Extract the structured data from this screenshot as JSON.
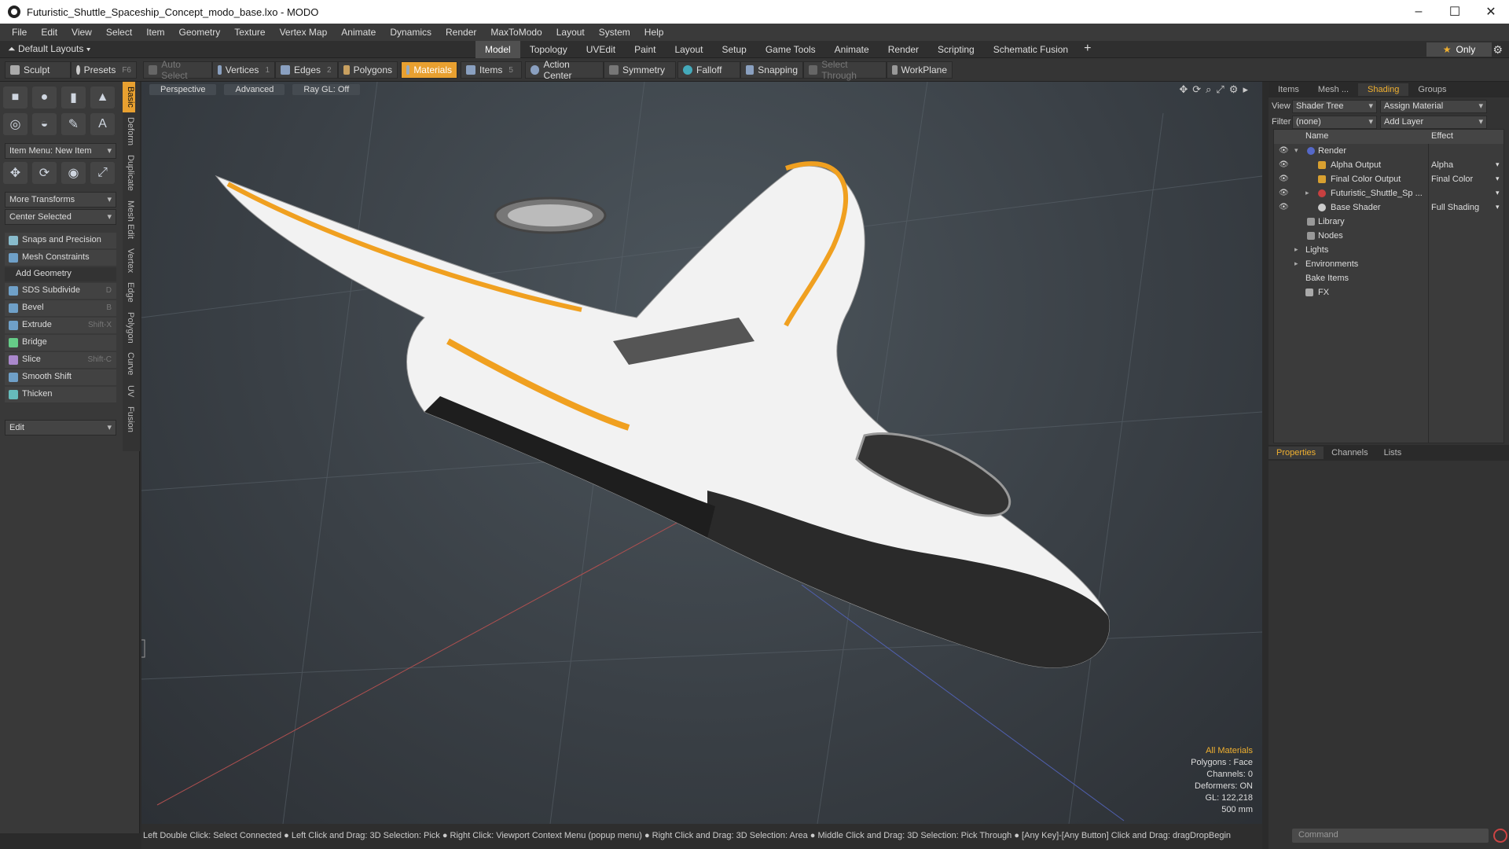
{
  "window": {
    "title": "Futuristic_Shuttle_Spaceship_Concept_modo_base.lxo - MODO"
  },
  "menu": [
    "File",
    "Edit",
    "View",
    "Select",
    "Item",
    "Geometry",
    "Texture",
    "Vertex Map",
    "Animate",
    "Dynamics",
    "Render",
    "MaxToModo",
    "Layout",
    "System",
    "Help"
  ],
  "layouts_label": "Default Layouts",
  "layout_tabs": [
    "Model",
    "Topology",
    "UVEdit",
    "Paint",
    "Layout",
    "Setup",
    "Game Tools",
    "Animate",
    "Render",
    "Scripting",
    "Schematic Fusion"
  ],
  "active_layout_tab": "Model",
  "only_label": "Only",
  "toolbar": {
    "sculpt": "Sculpt",
    "presets": "Presets",
    "presets_key": "F6",
    "auto_select": "Auto Select",
    "vertices": "Vertices",
    "vertices_key": "1",
    "edges": "Edges",
    "edges_key": "2",
    "polygons": "Polygons",
    "materials": "Materials",
    "items": "Items",
    "items_key": "5",
    "action_center": "Action Center",
    "symmetry": "Symmetry",
    "falloff": "Falloff",
    "snapping": "Snapping",
    "select_through": "Select Through",
    "workplane": "WorkPlane"
  },
  "left": {
    "vtabs": [
      "Basic",
      "Deform",
      "Duplicate",
      "Mesh Edit",
      "Vertex",
      "Edge",
      "Polygon",
      "Curve",
      "UV",
      "Fusion"
    ],
    "item_menu": "Item Menu: New Item",
    "more_transforms": "More Transforms",
    "center_selected": "Center Selected",
    "snaps": "Snaps and Precision",
    "mesh_constraints": "Mesh Constraints",
    "add_geometry": "Add Geometry",
    "tools": [
      {
        "label": "SDS Subdivide",
        "key": "D"
      },
      {
        "label": "Bevel",
        "key": "B"
      },
      {
        "label": "Extrude",
        "key": "Shift-X"
      },
      {
        "label": "Bridge",
        "key": ""
      },
      {
        "label": "Slice",
        "key": "Shift-C"
      },
      {
        "label": "Smooth Shift",
        "key": ""
      },
      {
        "label": "Thicken",
        "key": ""
      }
    ],
    "edit": "Edit"
  },
  "viewport": {
    "perspective": "Perspective",
    "advanced": "Advanced",
    "raygl": "Ray GL: Off",
    "info": {
      "materials": "All Materials",
      "polygons": "Polygons : Face",
      "channels": "Channels: 0",
      "deformers": "Deformers: ON",
      "gl": "GL: 122,218",
      "scale": "500 mm"
    }
  },
  "status": "Left Double Click: Select Connected ● Left Click and Drag: 3D Selection: Pick ● Right Click: Viewport Context Menu (popup menu) ● Right Click and Drag: 3D Selection: Area ● Middle Click and Drag: 3D Selection: Pick Through ● [Any Key]-[Any Button] Click and Drag: dragDropBegin",
  "right": {
    "tabs": [
      "Items",
      "Mesh ...",
      "Shading",
      "Groups"
    ],
    "active_tab": "Shading",
    "view_label": "View",
    "view_value": "Shader Tree",
    "assign_material": "Assign Material",
    "filter_label": "Filter",
    "filter_value": "(none)",
    "add_layer": "Add Layer",
    "col_name": "Name",
    "col_effect": "Effect",
    "tree": [
      {
        "name": "Render",
        "effect": ""
      },
      {
        "name": "Alpha Output",
        "effect": "Alpha"
      },
      {
        "name": "Final Color Output",
        "effect": "Final Color"
      },
      {
        "name": "Futuristic_Shuttle_Sp ...",
        "effect": ""
      },
      {
        "name": "Base Shader",
        "effect": "Full Shading"
      },
      {
        "name": "Library",
        "effect": ""
      },
      {
        "name": "Nodes",
        "effect": ""
      },
      {
        "name": "Lights",
        "effect": ""
      },
      {
        "name": "Environments",
        "effect": ""
      },
      {
        "name": "Bake Items",
        "effect": ""
      },
      {
        "name": "FX",
        "effect": ""
      }
    ],
    "prop_tabs": [
      "Properties",
      "Channels",
      "Lists"
    ],
    "active_prop_tab": "Properties",
    "command_placeholder": "Command"
  },
  "colors": {
    "accent": "#e8a030",
    "shuttle_white": "#f2f2f2",
    "shuttle_dark": "#2a2a2a",
    "stripe": "#f0a020"
  }
}
